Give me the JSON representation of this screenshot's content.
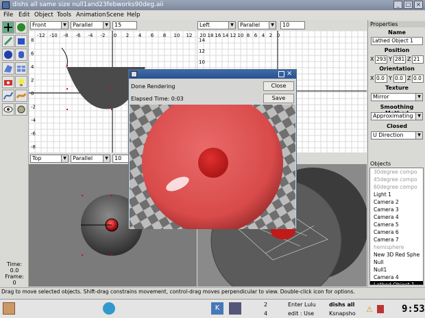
{
  "window": {
    "title": "dishs all same size null1and23febworks90deg.aii"
  },
  "menu": [
    "File",
    "Edit",
    "Object",
    "Tools",
    "Animation",
    "Scene",
    "Help"
  ],
  "viewports": {
    "topleft": {
      "view": "Front",
      "projection": "Parallel",
      "scale": "15",
      "hticks": [
        "-12",
        "-10",
        "-8",
        "-6",
        "-4",
        "-2",
        "0",
        "2",
        "4",
        "6",
        "8",
        "10",
        "12"
      ],
      "vticks": [
        "8",
        "6",
        "4",
        "2",
        "0",
        "-2",
        "-4",
        "-6",
        "-8"
      ]
    },
    "topright": {
      "view": "Left",
      "projection": "Parallel",
      "scale": "10",
      "hticks": [
        "20",
        "18",
        "16",
        "14",
        "12",
        "10",
        "8",
        "6",
        "4",
        "2",
        "0"
      ],
      "vticks": [
        "14",
        "12",
        "10"
      ]
    },
    "bottomleft": {
      "view": "Top",
      "projection": "Parallel",
      "scale": "10"
    }
  },
  "toolbox": {
    "time_label": "Time:",
    "time_value": "0.0",
    "frame_label": "Frame:",
    "frame_value": "0"
  },
  "properties": {
    "header": "Properties",
    "name_label": "Name",
    "name": "Lathed Object 1",
    "position_label": "Position",
    "px_label": "X",
    "px": "293",
    "py_label": "Y",
    "py": "281",
    "pz_label": "Z",
    "pz": "21",
    "orientation_label": "Orientation",
    "ox_label": "X",
    "ox": "0.0",
    "oy_label": "Y",
    "oy": "0.0",
    "oz_label": "Z",
    "oz": "0.0",
    "texture_label": "Texture",
    "texture": "Mirror",
    "smoothing_label": "Smoothing Method",
    "smoothing": "Approximating",
    "closed_label": "Closed",
    "closed": "U Direction"
  },
  "objects": {
    "header": "Objects",
    "items": [
      "30degree compo",
      "45degree compo",
      "60degree compo",
      "Light 1",
      "Camera 2",
      "Camera 3",
      "Camera 4",
      "Camera 5",
      "Camera 6",
      "Camera 7",
      "hemisphere",
      "New 3D Red Sphe",
      "Null",
      "Null1",
      "Camera 4",
      "Lathed Object 1"
    ],
    "selected": "Lathed Object 1"
  },
  "status": "Drag to move selected objects.  Shift-drag constrains movement, control-drag moves perpendicular to view.  Double-click icon for options.",
  "dialog": {
    "message": "Done Rendering",
    "elapsed": "Elapsed Time: 0:03",
    "close": "Close",
    "save": "Save"
  },
  "taskbar": {
    "desk1": "2",
    "desk2": "4",
    "task1": "Enter Lulu",
    "task2": "dishs all",
    "task3": "edit : Use",
    "task4": "Ksnapsho",
    "clock": "9:53"
  },
  "colors": {
    "titlebar": "#7c889c",
    "dialog_title": "#2a5290",
    "sphere": "#d94a4a",
    "selection": "#000000"
  }
}
